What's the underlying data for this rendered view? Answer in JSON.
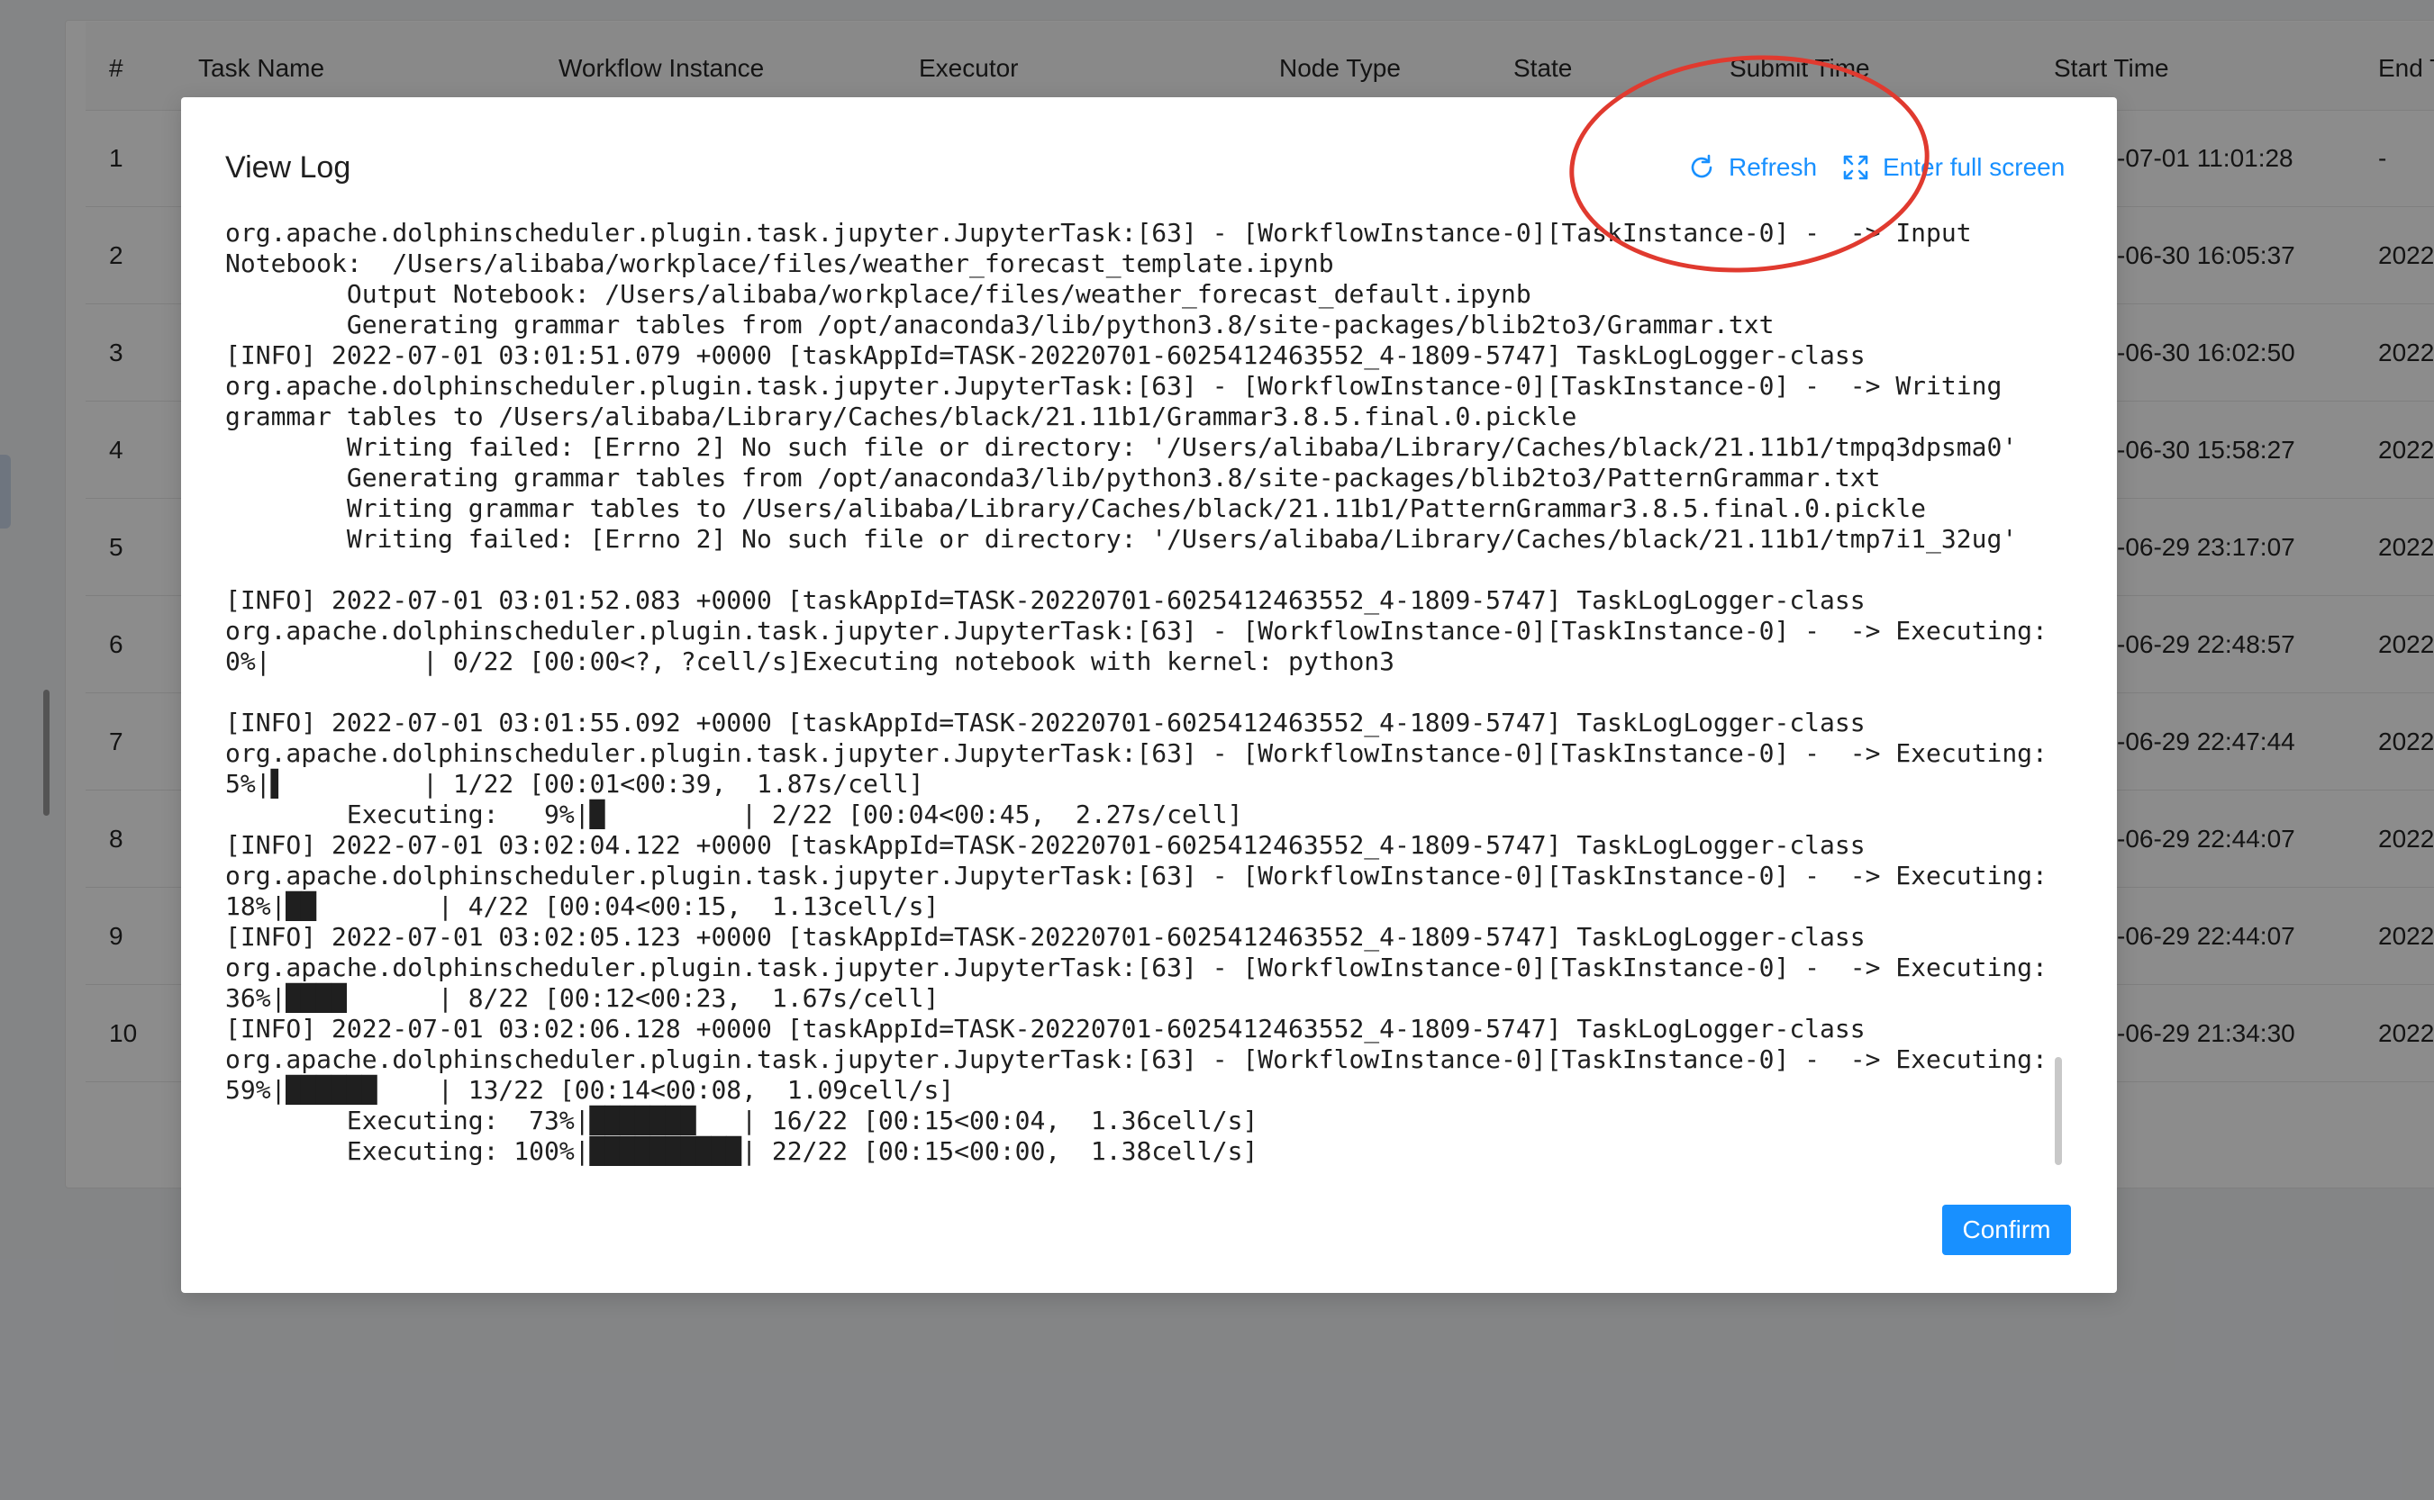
{
  "table": {
    "headers": [
      "#",
      "Task Name",
      "Workflow Instance",
      "Executor",
      "Node Type",
      "State",
      "Submit Time",
      "Start Time",
      "End T"
    ],
    "rows": [
      {
        "index": "1",
        "start_time": "-07-01 11:01:28",
        "end_time": "-"
      },
      {
        "index": "2",
        "start_time": "-06-30 16:05:37",
        "end_time": "2022"
      },
      {
        "index": "3",
        "start_time": "-06-30 16:02:50",
        "end_time": "2022"
      },
      {
        "index": "4",
        "start_time": "-06-30 15:58:27",
        "end_time": "2022"
      },
      {
        "index": "5",
        "start_time": "-06-29 23:17:07",
        "end_time": "2022"
      },
      {
        "index": "6",
        "start_time": "-06-29 22:48:57",
        "end_time": "2022"
      },
      {
        "index": "7",
        "start_time": "-06-29 22:47:44",
        "end_time": "2022"
      },
      {
        "index": "8",
        "start_time": "-06-29 22:44:07",
        "end_time": "2022"
      },
      {
        "index": "9",
        "start_time": "-06-29 22:44:07",
        "end_time": "2022"
      },
      {
        "index": "10",
        "start_time": "-06-29 21:34:30",
        "end_time": "2022"
      }
    ]
  },
  "modal": {
    "title": "View Log",
    "refresh_label": "Refresh",
    "fullscreen_label": "Enter full screen",
    "confirm_label": "Confirm",
    "log_text": "org.apache.dolphinscheduler.plugin.task.jupyter.JupyterTask:[63] - [WorkflowInstance-0][TaskInstance-0] -  -> Input\nNotebook:  /Users/alibaba/workplace/files/weather_forecast_template.ipynb\n        Output Notebook: /Users/alibaba/workplace/files/weather_forecast_default.ipynb\n        Generating grammar tables from /opt/anaconda3/lib/python3.8/site-packages/blib2to3/Grammar.txt\n[INFO] 2022-07-01 03:01:51.079 +0000 [taskAppId=TASK-20220701-6025412463552_4-1809-5747] TaskLogLogger-class\norg.apache.dolphinscheduler.plugin.task.jupyter.JupyterTask:[63] - [WorkflowInstance-0][TaskInstance-0] -  -> Writing\ngrammar tables to /Users/alibaba/Library/Caches/black/21.11b1/Grammar3.8.5.final.0.pickle\n        Writing failed: [Errno 2] No such file or directory: '/Users/alibaba/Library/Caches/black/21.11b1/tmpq3dpsma0'\n        Generating grammar tables from /opt/anaconda3/lib/python3.8/site-packages/blib2to3/PatternGrammar.txt\n        Writing grammar tables to /Users/alibaba/Library/Caches/black/21.11b1/PatternGrammar3.8.5.final.0.pickle\n        Writing failed: [Errno 2] No such file or directory: '/Users/alibaba/Library/Caches/black/21.11b1/tmp7i1_32ug'\n\n[INFO] 2022-07-01 03:01:52.083 +0000 [taskAppId=TASK-20220701-6025412463552_4-1809-5747] TaskLogLogger-class\norg.apache.dolphinscheduler.plugin.task.jupyter.JupyterTask:[63] - [WorkflowInstance-0][TaskInstance-0] -  -> Executing:\n0%|          | 0/22 [00:00<?, ?cell/s]Executing notebook with kernel: python3\n\n[INFO] 2022-07-01 03:01:55.092 +0000 [taskAppId=TASK-20220701-6025412463552_4-1809-5747] TaskLogLogger-class\norg.apache.dolphinscheduler.plugin.task.jupyter.JupyterTask:[63] - [WorkflowInstance-0][TaskInstance-0] -  -> Executing:\n5%|▌         | 1/22 [00:01<00:39,  1.87s/cell]\n        Executing:   9%|█         | 2/22 [00:04<00:45,  2.27s/cell]\n[INFO] 2022-07-01 03:02:04.122 +0000 [taskAppId=TASK-20220701-6025412463552_4-1809-5747] TaskLogLogger-class\norg.apache.dolphinscheduler.plugin.task.jupyter.JupyterTask:[63] - [WorkflowInstance-0][TaskInstance-0] -  -> Executing:\n18%|██        | 4/22 [00:04<00:15,  1.13cell/s]\n[INFO] 2022-07-01 03:02:05.123 +0000 [taskAppId=TASK-20220701-6025412463552_4-1809-5747] TaskLogLogger-class\norg.apache.dolphinscheduler.plugin.task.jupyter.JupyterTask:[63] - [WorkflowInstance-0][TaskInstance-0] -  -> Executing:\n36%|████      | 8/22 [00:12<00:23,  1.67s/cell]\n[INFO] 2022-07-01 03:02:06.128 +0000 [taskAppId=TASK-20220701-6025412463552_4-1809-5747] TaskLogLogger-class\norg.apache.dolphinscheduler.plugin.task.jupyter.JupyterTask:[63] - [WorkflowInstance-0][TaskInstance-0] -  -> Executing:\n59%|██████    | 13/22 [00:14<00:08,  1.09cell/s]\n        Executing:  73%|███████   | 16/22 [00:15<00:04,  1.36cell/s]\n        Executing: 100%|██████████| 22/22 [00:15<00:00,  1.38cell/s]"
  },
  "icons": {
    "refresh": "refresh-icon",
    "fullscreen": "fullscreen-icon"
  },
  "colors": {
    "accent": "#1890ff",
    "annotation": "#e03a2f",
    "mask": "rgba(0,0,0,0.45)"
  }
}
